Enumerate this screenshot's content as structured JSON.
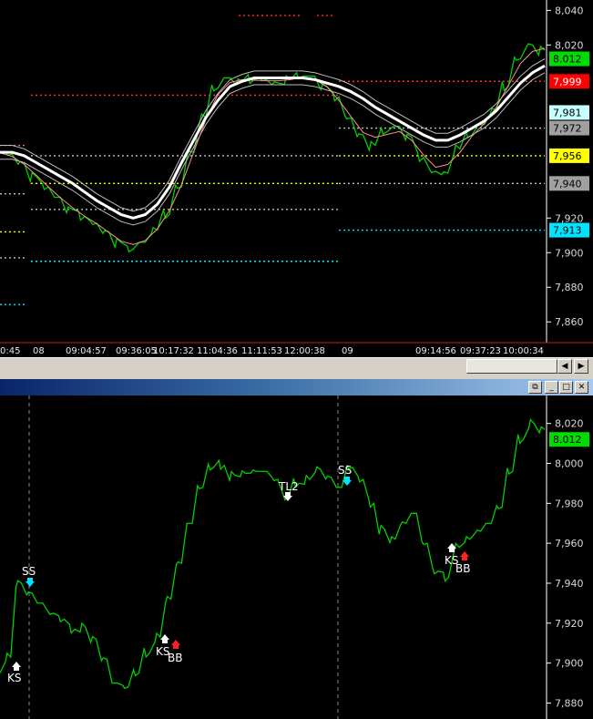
{
  "top_chart": {
    "y_ticks": [
      "8,040",
      "8,020",
      "7,920",
      "7,900",
      "7,880",
      "7,860"
    ],
    "badges": [
      {
        "label": "8,012",
        "bg": "#00dd00",
        "fg": "#000000",
        "value": 8012
      },
      {
        "label": "7,999",
        "bg": "#ff0000",
        "fg": "#ffffff",
        "value": 7999
      },
      {
        "label": "7,981",
        "bg": "#c6ffff",
        "fg": "#000000",
        "value": 7981
      },
      {
        "label": "7,972",
        "bg": "#a0a0a0",
        "fg": "#000000",
        "value": 7972
      },
      {
        "label": "7,956",
        "bg": "#ffff00",
        "fg": "#000000",
        "value": 7956
      },
      {
        "label": "7,940",
        "bg": "#a0a0a0",
        "fg": "#000000",
        "value": 7940
      },
      {
        "label": "7,913",
        "bg": "#00e5ff",
        "fg": "#000000",
        "value": 7913
      }
    ],
    "time_labels": [
      "0:45",
      "08",
      "09:04:57",
      "09:36:05",
      "10:17:32",
      "11:04:36",
      "11:11:53",
      "12:00:38",
      "09",
      "09:14:56",
      "09:37:23",
      "10:00:34"
    ]
  },
  "bottom_chart": {
    "y_ticks": [
      "8,020",
      "8,000",
      "7,980",
      "7,960",
      "7,940",
      "7,920",
      "7,900",
      "7,880"
    ],
    "last_badge": {
      "label": "8,012",
      "bg": "#00dd00",
      "fg": "#000000"
    },
    "signals": [
      "SS",
      "KS",
      "KS",
      "BB",
      "TL2",
      "SS",
      "KS",
      "BB"
    ]
  },
  "window": {
    "scroll_left_icon": "arrow-left-icon",
    "scroll_right_icon": "arrow-right-icon",
    "buttons": [
      "restore-icon",
      "minimize-icon",
      "maximize-icon",
      "close-icon"
    ]
  },
  "chart_data": [
    {
      "type": "line",
      "ylim": [
        7848,
        8046
      ],
      "y_tick_values": [
        8040,
        8020,
        7920,
        7900,
        7880,
        7860
      ],
      "series": [
        {
          "values": [
            7958,
            7957,
            7952,
            7944,
            7938,
            7932,
            7925,
            7921,
            7917,
            7912,
            7906,
            7902,
            7906,
            7913,
            7922,
            7938,
            7958,
            7978,
            7995,
            8001,
            7999,
            8000,
            8000,
            7998,
            8000,
            8002,
            8002,
            7996,
            7990,
            7978,
            7968,
            7962,
            7970,
            7973,
            7967,
            7955,
            7947,
            7946,
            7960,
            7968,
            7974,
            7982,
            7996,
            8012,
            8020,
            8017
          ]
        },
        {
          "values": [
            7958,
            7958,
            7956,
            7952,
            7948,
            7944,
            7940,
            7935,
            7930,
            7926,
            7922,
            7920,
            7922,
            7928,
            7938,
            7952,
            7965,
            7978,
            7988,
            7996,
            7999,
            8001,
            8001,
            8001,
            8001,
            8001,
            8000,
            7998,
            7996,
            7993,
            7989,
            7984,
            7980,
            7976,
            7972,
            7968,
            7965,
            7965,
            7968,
            7972,
            7976,
            7982,
            7990,
            7998,
            8004,
            8008
          ]
        }
      ]
    },
    {
      "type": "line",
      "ylim": [
        7872,
        8034
      ],
      "y_tick_values": [
        8020,
        8000,
        7980,
        7960,
        7940,
        7920,
        7900,
        7880
      ],
      "series": [
        {
          "values": [
            7895,
            7903,
            7940,
            7935,
            7930,
            7925,
            7922,
            7917,
            7918,
            7912,
            7902,
            7890,
            7888,
            7895,
            7905,
            7913,
            7932,
            7950,
            7970,
            7988,
            7998,
            7999,
            7994,
            7995,
            7996,
            7996,
            7992,
            7983,
            7990,
            7992,
            7997,
            7993,
            7988,
            7998,
            7992,
            7980,
            7967,
            7962,
            7970,
            7975,
            7960,
            7946,
            7943,
            7958,
            7962,
            7966,
            7970,
            7978,
            7996,
            8012,
            8020,
            8017
          ]
        }
      ]
    }
  ]
}
